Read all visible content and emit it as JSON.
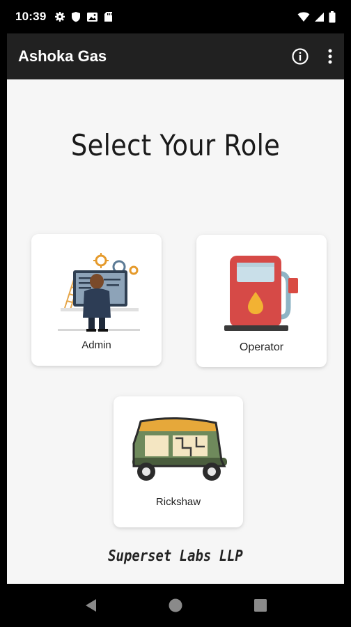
{
  "status_bar": {
    "time": "10:39",
    "icons": [
      "settings-icon",
      "shield-icon",
      "image-icon",
      "sd-card-icon",
      "wifi-icon",
      "signal-icon",
      "battery-icon"
    ]
  },
  "app_bar": {
    "title": "Ashoka Gas",
    "actions": [
      "info-icon",
      "overflow-menu-icon"
    ],
    "background": "#212121"
  },
  "main": {
    "heading": "Select Your Role",
    "roles": [
      {
        "label": "Admin",
        "icon": "admin-illustration"
      },
      {
        "label": "Operator",
        "icon": "fuel-pump-illustration"
      },
      {
        "label": "Rickshaw",
        "icon": "auto-rickshaw-illustration"
      }
    ],
    "footer": "Superset Labs LLP",
    "background": "#f6f6f6"
  },
  "nav_bar": {
    "buttons": [
      "back-icon",
      "home-icon",
      "recents-icon"
    ]
  }
}
